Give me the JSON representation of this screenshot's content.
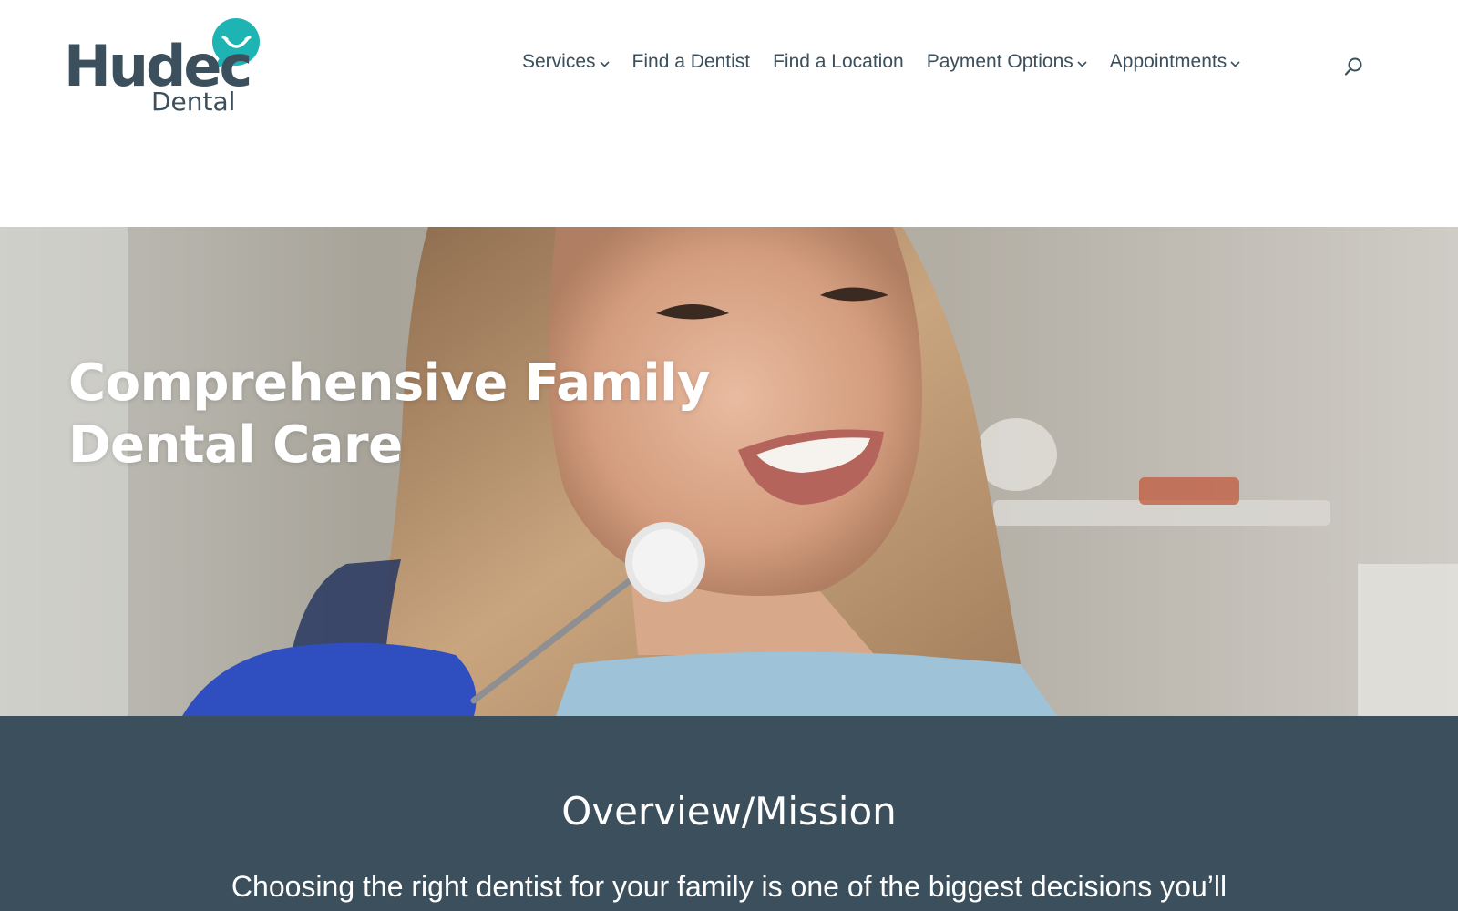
{
  "brand": {
    "name_main": "Hudec",
    "name_sub": "Dental",
    "accent_color": "#1fb4b4",
    "text_color": "#3b4f5c"
  },
  "nav": {
    "items": [
      {
        "label": "Services",
        "has_dropdown": true
      },
      {
        "label": "Find a Dentist",
        "has_dropdown": false
      },
      {
        "label": "Find a Location",
        "has_dropdown": false
      },
      {
        "label": "Payment Options",
        "has_dropdown": true
      },
      {
        "label": "Appointments",
        "has_dropdown": true
      }
    ],
    "search_icon": "search-icon"
  },
  "hero": {
    "title_line1": "Comprehensive Family",
    "title_line2": "Dental Care",
    "image": "smiling woman in dental chair with dental mirror"
  },
  "overview": {
    "heading": "Overview/Mission",
    "text": "Choosing the right dentist for your family is one of the biggest decisions you’ll",
    "background_color": "#3b4f5c"
  }
}
